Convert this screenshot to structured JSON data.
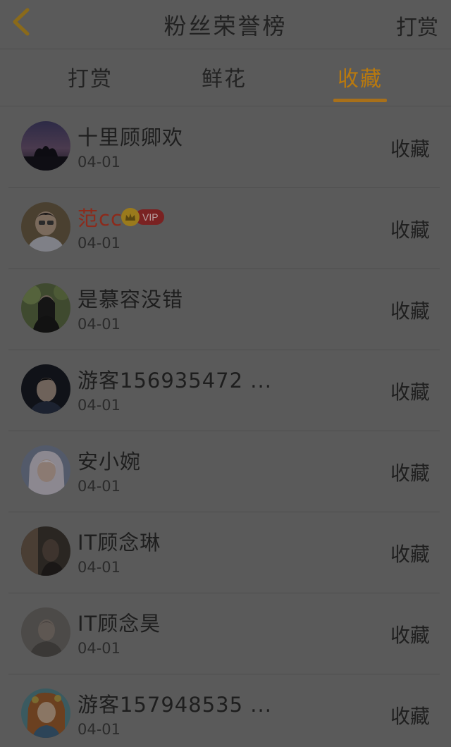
{
  "header": {
    "title": "粉丝荣誉榜",
    "action_label": "打赏"
  },
  "tabs": [
    {
      "label": "打赏",
      "active": false
    },
    {
      "label": "鲜花",
      "active": false
    },
    {
      "label": "收藏",
      "active": true
    }
  ],
  "colors": {
    "active_tab": "#b9790e",
    "vip_name": "#8c2a1b",
    "overlay_background": "#5a5a5a"
  },
  "fans": [
    {
      "name": "十里顾卿欢",
      "date": "04-01",
      "action": "收藏",
      "vip": false
    },
    {
      "name": "范cc",
      "date": "04-01",
      "action": "收藏",
      "vip": true,
      "vip_label": "VIP"
    },
    {
      "name": "是慕容没错",
      "date": "04-01",
      "action": "收藏",
      "vip": false
    },
    {
      "name": "游客156935472 ...",
      "date": "04-01",
      "action": "收藏",
      "vip": false
    },
    {
      "name": "安小婉",
      "date": "04-01",
      "action": "收藏",
      "vip": false
    },
    {
      "name": "IT顾念琳",
      "date": "04-01",
      "action": "收藏",
      "vip": false
    },
    {
      "name": "IT顾念昊",
      "date": "04-01",
      "action": "收藏",
      "vip": false
    },
    {
      "name": "游客157948535 ...",
      "date": "04-01",
      "action": "收藏",
      "vip": false
    }
  ]
}
